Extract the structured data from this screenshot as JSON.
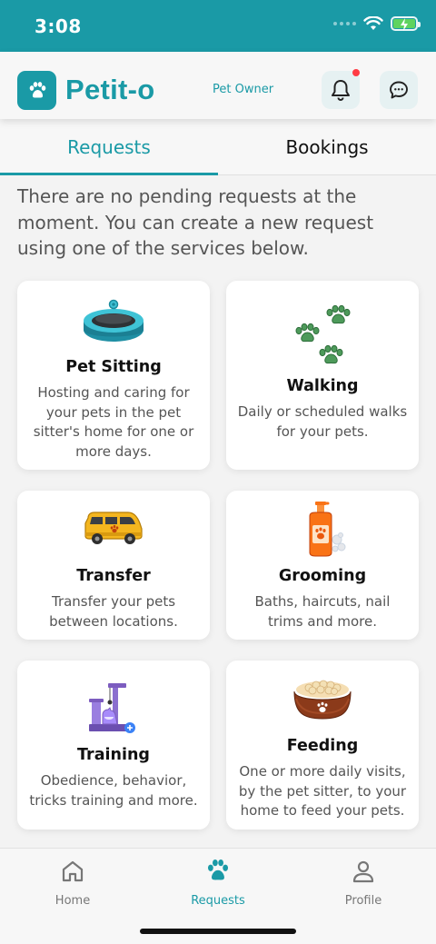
{
  "status_bar": {
    "time": "3:08"
  },
  "header": {
    "app_name": "Petit-o",
    "role": "Pet Owner",
    "logo_icon": "paw-icon",
    "notifications_icon": "bell-icon",
    "messages_icon": "chat-icon"
  },
  "tabs": [
    {
      "label": "Requests",
      "active": true
    },
    {
      "label": "Bookings",
      "active": false
    }
  ],
  "empty_message": "There are no pending requests at the moment. You can create a new request using one of the services below.",
  "services": [
    {
      "title": "Pet Sitting",
      "description": "Hosting and caring for your pets in the pet sitter's home for one or more days.",
      "icon": "pet-bed-icon"
    },
    {
      "title": "Walking",
      "description": "Daily or scheduled walks for your pets.",
      "icon": "paw-prints-icon"
    },
    {
      "title": "Transfer",
      "description": "Transfer your pets between locations.",
      "icon": "van-icon"
    },
    {
      "title": "Grooming",
      "description": "Baths, haircuts, nail trims and more.",
      "icon": "shampoo-bottle-icon"
    },
    {
      "title": "Training",
      "description": "Obedience, behavior, tricks training and more.",
      "icon": "cat-tree-icon"
    },
    {
      "title": "Feeding",
      "description": "One or more daily visits, by the pet sitter, to your home to feed your pets.",
      "icon": "food-bowl-icon"
    }
  ],
  "bottom_nav": [
    {
      "label": "Home",
      "icon": "home-icon",
      "active": false
    },
    {
      "label": "Requests",
      "icon": "paw-icon",
      "active": true
    },
    {
      "label": "Profile",
      "icon": "person-icon",
      "active": false
    }
  ],
  "colors": {
    "accent": "#1a9aa6",
    "notification": "#ff3b44",
    "battery": "#5fd35f"
  }
}
